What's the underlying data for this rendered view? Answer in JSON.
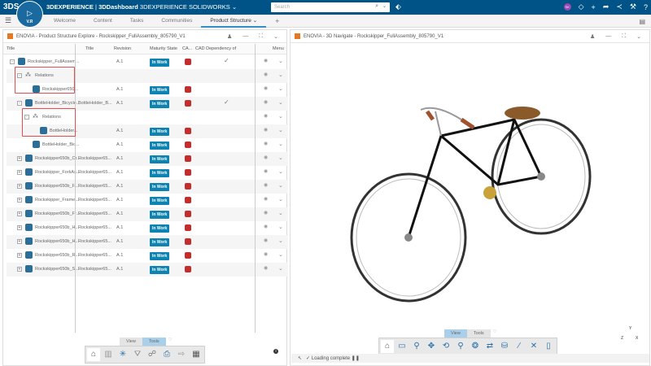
{
  "topbar": {
    "logo": "3DS",
    "compass": "V.R",
    "brand": "3DEXPERIENCE",
    "separator": " | ",
    "dashboard": "3DDashboard",
    "app": "3DEXPERIENCE SOLIDWORKS",
    "search_placeholder": "Search",
    "avatar": "SK"
  },
  "tabs": [
    {
      "label": "Welcome"
    },
    {
      "label": "Content"
    },
    {
      "label": "Tasks"
    },
    {
      "label": "Communities"
    },
    {
      "label": "Product Structure",
      "active": true
    }
  ],
  "left_panel": {
    "title": "ENOVIA - Product Structure Explore - Rockskipper_FullAssembly_805790_V1",
    "columns": [
      "Title",
      "Title",
      "Revision",
      "Maturity State",
      "CA...",
      "CAD Dependency of",
      "",
      "Menu"
    ],
    "rows": [
      {
        "title": "Rockskipper_FullAssem...",
        "title2": "",
        "revision": "A.1",
        "state": "In Work",
        "cad": true,
        "dep": true,
        "level": 0,
        "exp": "-"
      },
      {
        "title": "Relations",
        "title2": "",
        "revision": "",
        "state": "",
        "cad": false,
        "dep": false,
        "level": 1,
        "exp": "-",
        "rel": true
      },
      {
        "title": "Rockskipper650...",
        "title2": "",
        "revision": "A.1",
        "state": "In Work",
        "cad": true,
        "dep": false,
        "level": 2,
        "exp": ""
      },
      {
        "title": "BottleHolder_Bicycle...",
        "title2": "BottleHolder_B...",
        "revision": "A.1",
        "state": "In Work",
        "cad": true,
        "dep": true,
        "level": 1,
        "exp": "-"
      },
      {
        "title": "Relations",
        "title2": "",
        "revision": "",
        "state": "",
        "cad": false,
        "dep": false,
        "level": 2,
        "exp": "-",
        "rel": true
      },
      {
        "title": "BottleHolder...",
        "title2": "",
        "revision": "A.1",
        "state": "In Work",
        "cad": true,
        "dep": false,
        "level": 3,
        "exp": ""
      },
      {
        "title": "BottleHolder_Bic...",
        "title2": "",
        "revision": "A.1",
        "state": "In Work",
        "cad": true,
        "dep": false,
        "level": 2,
        "exp": ""
      },
      {
        "title": "Rockskipper650b_Cr...",
        "title2": "Rockskipper65...",
        "revision": "A.1",
        "state": "In Work",
        "cad": true,
        "dep": false,
        "level": 1,
        "exp": "+"
      },
      {
        "title": "Rockskipper_ForkAs...",
        "title2": "Rockskipper65...",
        "revision": "A.1",
        "state": "In Work",
        "cad": true,
        "dep": false,
        "level": 1,
        "exp": "+"
      },
      {
        "title": "Rockskipper650b_F...",
        "title2": "Rockskipper65...",
        "revision": "A.1",
        "state": "In Work",
        "cad": true,
        "dep": false,
        "level": 1,
        "exp": "+"
      },
      {
        "title": "Rockskipper_Frame...",
        "title2": "Rockskipper65...",
        "revision": "A.1",
        "state": "In Work",
        "cad": true,
        "dep": false,
        "level": 1,
        "exp": "+"
      },
      {
        "title": "Rockskipper650b_Fr...",
        "title2": "Rockskipper65...",
        "revision": "A.1",
        "state": "In Work",
        "cad": true,
        "dep": false,
        "level": 1,
        "exp": "+"
      },
      {
        "title": "Rockskipper650b_H...",
        "title2": "Rockskipper65...",
        "revision": "A.1",
        "state": "In Work",
        "cad": true,
        "dep": false,
        "level": 1,
        "exp": "+"
      },
      {
        "title": "Rockskipper650b_H...",
        "title2": "Rockskipper65...",
        "revision": "A.1",
        "state": "In Work",
        "cad": true,
        "dep": false,
        "level": 1,
        "exp": "+"
      },
      {
        "title": "Rockskipper650b_R...",
        "title2": "Rockskipper65...",
        "revision": "A.1",
        "state": "In Work",
        "cad": true,
        "dep": false,
        "level": 1,
        "exp": "+"
      },
      {
        "title": "Rockskipper650b_S...",
        "title2": "Rockskipper65...",
        "revision": "A.1",
        "state": "In Work",
        "cad": true,
        "dep": false,
        "level": 1,
        "exp": "+"
      }
    ],
    "view_tab": "View",
    "tools_tab": "Tools",
    "info": "i"
  },
  "right_panel": {
    "title": "ENOVIA - 3D Navigate - Rockskipper_FullAssembly_805790_V1",
    "view_tab": "View",
    "tools_tab": "Tools",
    "status": "Loading complete",
    "axes": {
      "x": "X",
      "y": "Y",
      "z": "Z"
    }
  },
  "colors": {
    "topbar": "#005386",
    "badge": "#0e83b1",
    "accent": "#368ec4",
    "enovia": "#e87722"
  }
}
